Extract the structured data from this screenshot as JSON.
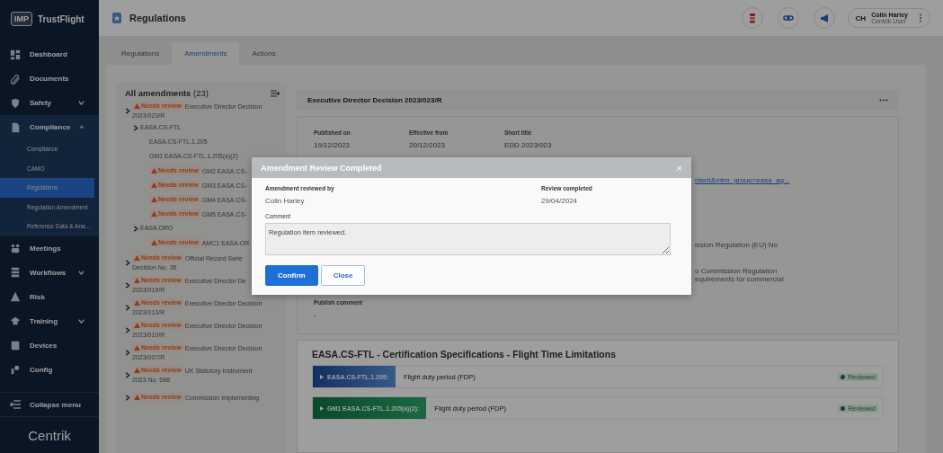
{
  "brand": {
    "logo": "IMP",
    "name": "TrustFlight"
  },
  "sidebar": {
    "items": [
      {
        "label": "Dashboard",
        "selected": false
      },
      {
        "label": "Documents",
        "selected": false
      },
      {
        "label": "Safety",
        "selected": false,
        "expanded": false
      },
      {
        "label": "Compliance",
        "selected": false,
        "expanded": true,
        "children": [
          {
            "label": "Compliance",
            "selected": false
          },
          {
            "label": "CAMO",
            "selected": false
          },
          {
            "label": "Regulations",
            "selected": true
          },
          {
            "label": "Regulation Amendment",
            "selected": false
          },
          {
            "label": "Reference Data & Ana...",
            "selected": false
          }
        ]
      },
      {
        "label": "Meetings",
        "selected": false
      },
      {
        "label": "Workflows",
        "selected": false,
        "expanded": false
      },
      {
        "label": "Risk",
        "selected": false
      },
      {
        "label": "Training",
        "selected": false,
        "expanded": false
      },
      {
        "label": "Devices",
        "selected": false
      },
      {
        "label": "Config",
        "selected": false
      }
    ],
    "collapse": "Collapse menu",
    "footer_logo": "Centrik"
  },
  "header": {
    "title": "Regulations",
    "user": {
      "initials": "CH",
      "name": "Colin Harley",
      "role": "Centrik User"
    }
  },
  "tabs": [
    {
      "label": "Regulations",
      "selected": false
    },
    {
      "label": "Amendments",
      "selected": true
    },
    {
      "label": "Actions",
      "selected": false
    }
  ],
  "tree": {
    "title": "All amendments",
    "count": "(23)",
    "items": [
      {
        "badge": "Needs review",
        "title": "Executive Director Decision\n2023/023/R",
        "children": [
          {
            "title": "EASA.CS-FTL",
            "children": [
              {
                "title": "EASA.CS-FTL.1.205"
              },
              {
                "title": "GM1 EASA.CS-FTL.1.205(a)(2)"
              },
              {
                "badge": "Needs review",
                "title": "GM2 EASA.CS-"
              },
              {
                "badge": "Needs review",
                "title": "GM3 EASA.CS-"
              },
              {
                "badge": "Needs review",
                "title": "GM4 EASA.CS-"
              },
              {
                "badge": "Needs review",
                "title": "GM5 EASA.CS-"
              }
            ]
          },
          {
            "title": "EASA.ORO",
            "children": [
              {
                "badge": "Needs review",
                "title": "AMC1 EASA.OR"
              }
            ]
          }
        ]
      },
      {
        "badge": "Needs review",
        "title": "Official Record Serie\nDecision No. 35",
        "expandable": true
      },
      {
        "badge": "Needs review",
        "title": "Executive Director De\n2023/019/R",
        "expandable": true
      },
      {
        "badge": "Needs review",
        "title": "Executive Director Decision\n2023/013/R",
        "expandable": true
      },
      {
        "badge": "Needs review",
        "title": "Executive Director Decision\n2023/010/R",
        "expandable": true
      },
      {
        "badge": "Needs review",
        "title": "Executive Director Decision\n2023/007/R",
        "expandable": true
      },
      {
        "badge": "Needs review",
        "title": "UK Statutory Instrument\n2023 No. 588",
        "expandable": true
      },
      {
        "badge": "Needs review",
        "title": "Commission Implementing",
        "expandable": true
      }
    ]
  },
  "detail": {
    "title": "Executive Director Decision 2023/023/R",
    "fields": [
      {
        "label": "Published on",
        "value": "19/12/2023"
      },
      {
        "label": "Effective from",
        "value": "20/12/2023"
      },
      {
        "label": "Short title",
        "value": "EDD 2023/023"
      }
    ],
    "covered": [
      {
        "kind": "link",
        "lines": [
          "ntent&mtm_group=easa_ag..."
        ]
      },
      {
        "kind": "text",
        "lines": [
          "ission Regulation (EU) No"
        ]
      },
      {
        "kind": "text",
        "lines": [
          "o Commission Regulation",
          "equirements for commercial"
        ]
      }
    ],
    "publish_comment": {
      "label": "Publish comment",
      "value": "-"
    }
  },
  "section": {
    "title": "EASA.CS-FTL - Certification Specifications - Flight Time Limitations",
    "rows": [
      {
        "kind": "regulation",
        "code": "EASA.CS-FTL.1.205:",
        "text": "Flight duty period (FDP)",
        "status": "Reviewed"
      },
      {
        "kind": "guidance",
        "code": "GM1 EASA.CS-FTL.1.205(a)(2):",
        "text": "Flight duty period (FDP)",
        "status": "Reviewed"
      }
    ]
  },
  "modal": {
    "title": "Amendment Review Completed",
    "close": "×",
    "fields": [
      {
        "label": "Amendment reviewed by",
        "value": "Colin Harley"
      },
      {
        "label": "Review completed",
        "value": "29/04/2024"
      }
    ],
    "comment": {
      "label": "Comment",
      "value": "Regulation item reviewed."
    },
    "buttons": [
      {
        "label": "Confirm",
        "kind": "primary"
      },
      {
        "label": "Close",
        "kind": "secondary"
      }
    ]
  }
}
